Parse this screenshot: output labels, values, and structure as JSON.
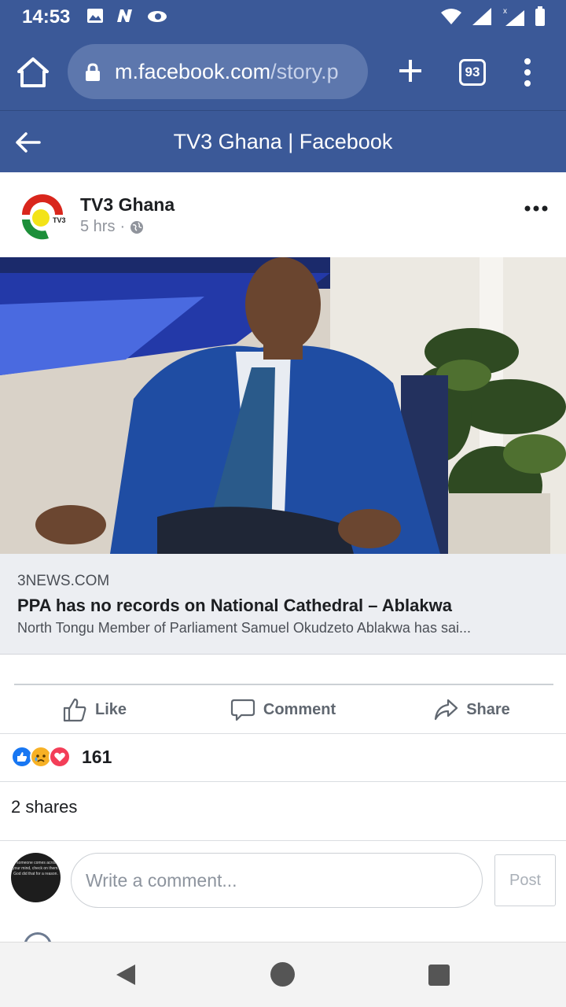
{
  "status_bar": {
    "time": "14:53",
    "left_icons": [
      "image-icon",
      "n-notification-icon",
      "eye-notification-icon"
    ],
    "right_icons": [
      "wifi-icon",
      "signal-icon",
      "signal-x-icon",
      "battery-icon"
    ],
    "signal_x_badge": "x"
  },
  "browser": {
    "url_domain": "m.facebook.com",
    "url_path": "/story.p",
    "tab_count": "93",
    "theme_color": "#3b5998"
  },
  "page_header": {
    "title": "TV3 Ghana | Facebook"
  },
  "post": {
    "author": "TV3 Ghana",
    "time": "5 hrs",
    "separator": "·",
    "logo_text": "TV3",
    "image_description_icon": "post-photo"
  },
  "link_preview": {
    "domain": "3NEWS.COM",
    "title": "PPA has no records on National Cathedral – Ablakwa",
    "description": "North Tongu Member of Parliament Samuel Okudzeto Ablakwa has sai..."
  },
  "actions": {
    "like": "Like",
    "comment": "Comment",
    "share": "Share"
  },
  "reactions": {
    "types": [
      "like-reaction-icon",
      "sad-reaction-icon",
      "love-reaction-icon"
    ],
    "count": "161"
  },
  "shares": "2 shares",
  "composer": {
    "avatar_text": "If someone comes across your mind, check on them. God did that for a reason.",
    "placeholder": "Write a comment...",
    "post_label": "Post"
  }
}
